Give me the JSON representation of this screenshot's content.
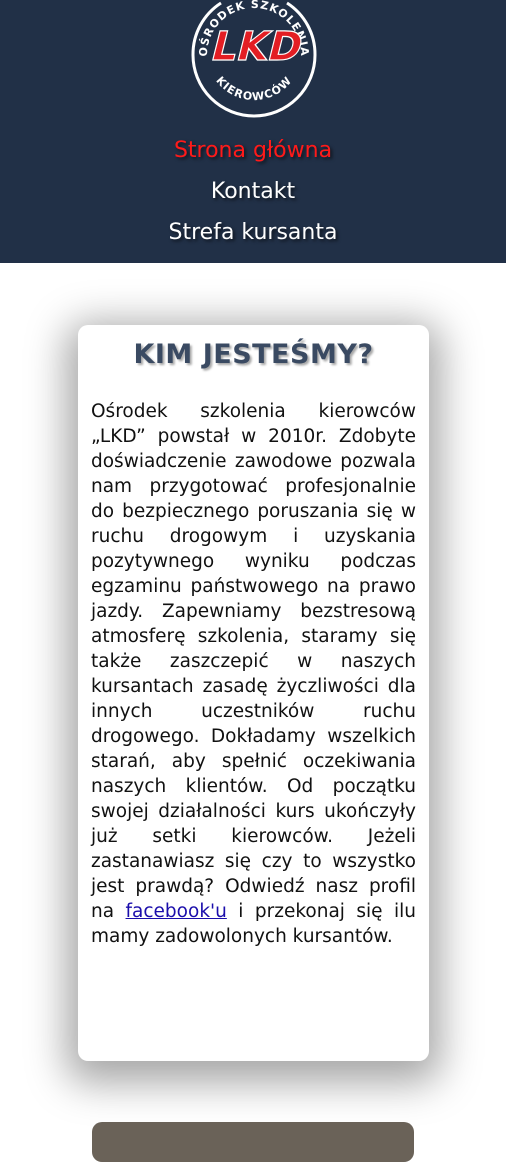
{
  "header": {
    "logo": {
      "ring_text_top": "OŚRODEK SZKOLENIA",
      "ring_text_bottom": "KIEROWCÓW",
      "brand": "LKD",
      "brand_color": "#e31e24"
    },
    "nav": [
      {
        "label": "Strona główna",
        "active": true
      },
      {
        "label": "Kontakt",
        "active": false
      },
      {
        "label": "Strefa kursanta",
        "active": false
      }
    ],
    "bg_color": "#213047"
  },
  "about": {
    "title": "KIM JESTEŚMY?",
    "text_before_link": "Ośrodek szkolenia kierowców „LKD” powstał w 2010r. Zdobyte doświadczenie zawodowe pozwala nam przygotować profesjonalnie do bezpiecznego poruszania się w ruchu drogowym i uzyskania pozytywnego wyniku podczas egzaminu państwowego na prawo jazdy. Zapewniamy bezstresową atmosferę szkolenia, staramy się także zaszczepić w naszych kursantach zasadę życzliwości dla innych uczestników ruchu drogowego. Dokładamy wszelkich starań, aby spełnić oczekiwania naszych klientów. Od początku swojej działalności kurs ukończyły już setki kierowców. Jeżeli zastanawiasz się czy to wszystko jest prawdą? Odwiedź nasz profil na ",
    "link_text": "facebook'u",
    "text_after_link": " i przekonaj się ilu mamy zadowolonych kursantów."
  }
}
